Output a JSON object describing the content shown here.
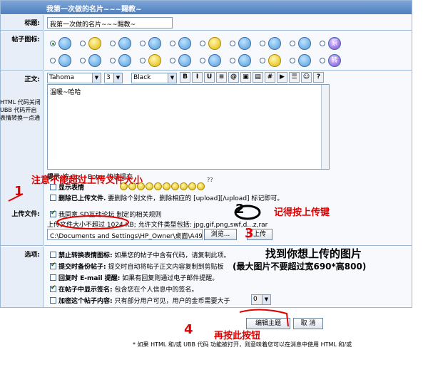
{
  "header": {
    "title": "我第一次做的名片~~~賜教~"
  },
  "title_row": {
    "label": "标题:",
    "value": "我第一次做的名片~~~賜教~"
  },
  "icon_row": {
    "label": "帖子图标:",
    "text_icons": [
      "原",
      "转"
    ]
  },
  "body_row": {
    "label": "正文:",
    "left_notes": [
      "HTML 代码关闭",
      "UBB  代码开启",
      "表情转换一点通"
    ],
    "font_select": "Tahoma",
    "size_select": "3",
    "color_select": "Black",
    "toolbar": [
      "B",
      "I",
      "U",
      "≡",
      "@",
      "▣",
      "▤",
      "#",
      "▶",
      "☰",
      "☺",
      "?"
    ],
    "content": "溫暖~哈哈",
    "hint_label": "提示:",
    "hint_text": "按 Ctrl+Enter 快速提交",
    "smile_label": "显示表情",
    "smile_more": "??",
    "delete_label": "删除已上传文件.",
    "delete_text": "要删除个别文件，删除相应的 [upload][/upload] 标记即可。"
  },
  "upload_row": {
    "label": "上传文件:",
    "agree_text": "我同意 SD互动论坛 制定的相关规则",
    "size_limit": "上传文件大小不超过 1024 KB; 允许文件类型包括: jpg,gif,png,swf,d...z,rar",
    "file_path": "C:\\Documents and Settings\\HP_Owner\\桌面\\A49",
    "browse_label": "浏览...",
    "upload_label": "上传"
  },
  "options_row": {
    "label": "选项:",
    "items": [
      {
        "title": "禁止转换表情图标:",
        "desc": "如果您的帖子中含有代码，请复制此项。",
        "checked": false
      },
      {
        "title": "提交时备份帖子:",
        "desc": "提交时自动将帖子正文内容复制到剪贴板",
        "checked": true
      },
      {
        "title": "回复时 E-mail 提醒:",
        "desc": "如果有回复则通过电子邮件提醒。",
        "checked": false
      },
      {
        "title": "在帖子中显示签名:",
        "desc": "包含您在个人信息中的签名。",
        "checked": true
      },
      {
        "title": "加密这个帖子内容:",
        "desc": "只有部分用户可见，用户的金币需要大于",
        "checked": false
      }
    ],
    "gold_value": "0"
  },
  "buttons": {
    "submit_label": "编辑主题",
    "cancel_label": "取 消"
  },
  "footer_note": "* 如果 HTML 和/或 UBB 代码 功能被打开，则意味着您可以在消息中使用 HTML 和/或",
  "annotations": {
    "step1": "注意不能超过上传文件大小",
    "step2": "记得按上传键",
    "step3_main": "找到你想上传的图片",
    "step3_sub": "(最大图片不要超过宽690*高800)",
    "step4": "再按此按钮",
    "mark_1": "1",
    "mark_2": "2",
    "mark_3": "3",
    "mark_4": "4"
  }
}
